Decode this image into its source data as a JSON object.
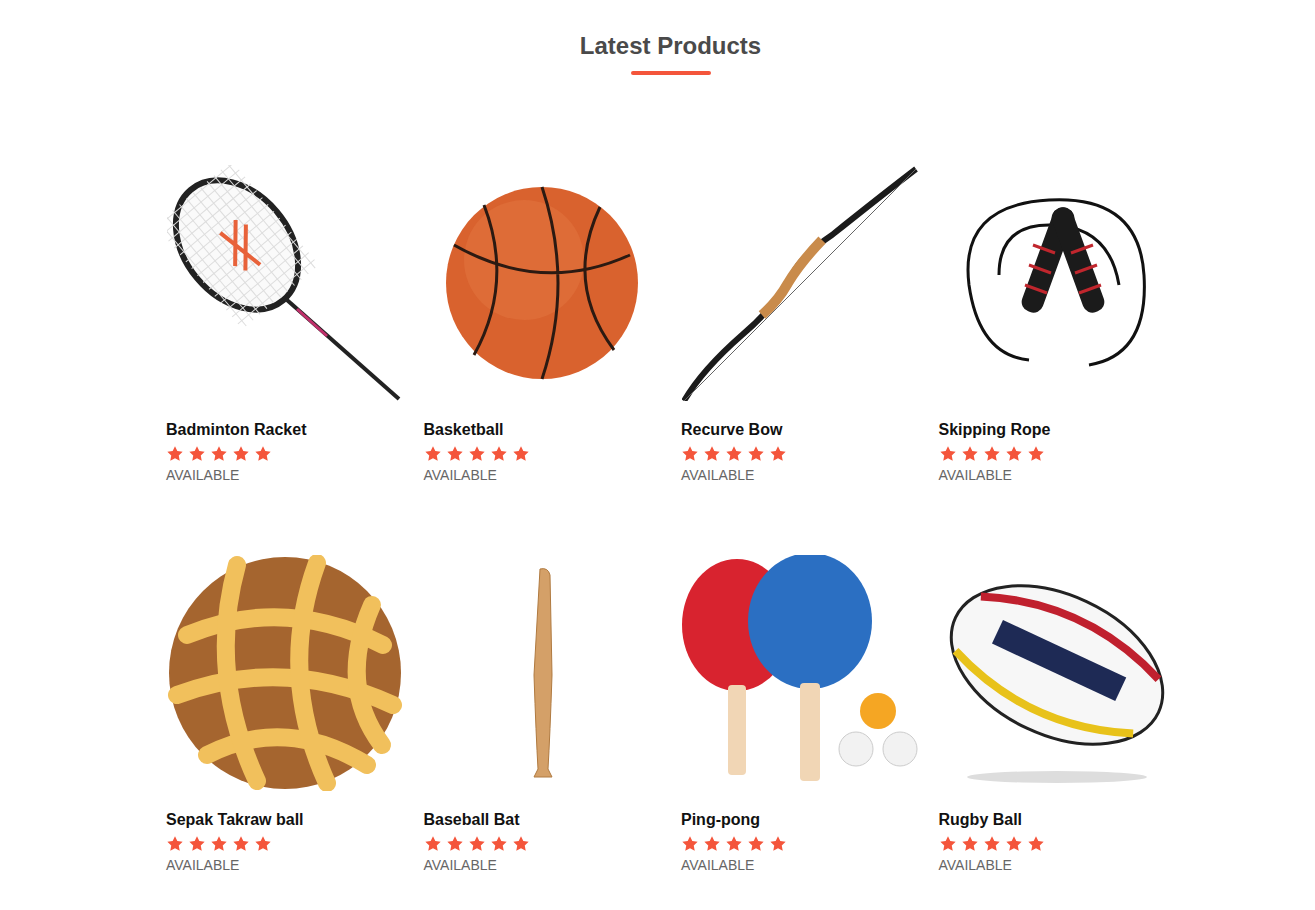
{
  "section": {
    "title": "Latest Products"
  },
  "products": [
    {
      "name": "Badminton Racket",
      "stars": 5,
      "status": "AVAILABLE"
    },
    {
      "name": "Basketball",
      "stars": 5,
      "status": "AVAILABLE"
    },
    {
      "name": "Recurve Bow",
      "stars": 5,
      "status": "AVAILABLE"
    },
    {
      "name": "Skipping Rope",
      "stars": 5,
      "status": "AVAILABLE"
    },
    {
      "name": "Sepak Takraw ball",
      "stars": 5,
      "status": "AVAILABLE"
    },
    {
      "name": "Baseball Bat",
      "stars": 5,
      "status": "AVAILABLE"
    },
    {
      "name": "Ping-pong",
      "stars": 5,
      "status": "AVAILABLE"
    },
    {
      "name": "Rugby Ball",
      "stars": 5,
      "status": "AVAILABLE"
    }
  ]
}
